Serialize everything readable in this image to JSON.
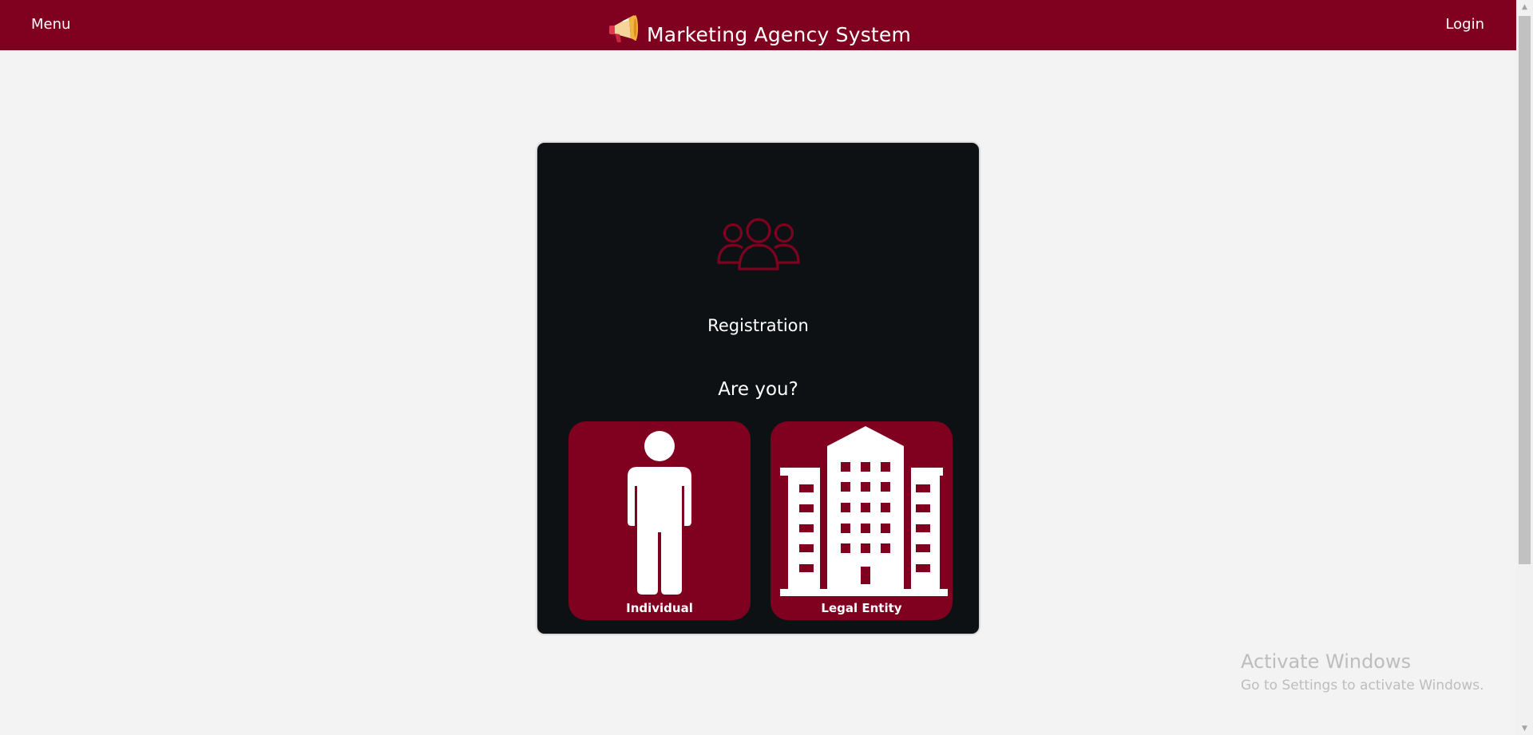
{
  "header": {
    "menu_label": "Menu",
    "title": "Marketing Agency System",
    "logo_icon": "megaphone-icon",
    "login_label": "Login"
  },
  "card": {
    "icon": "users-group-icon",
    "title": "Registration",
    "question": "Are you?",
    "options": [
      {
        "label": "Individual",
        "icon": "person-icon"
      },
      {
        "label": "Legal Entity",
        "icon": "building-icon"
      }
    ]
  },
  "watermark": {
    "title": "Activate Windows",
    "subtitle": "Go to Settings to activate Windows."
  },
  "colors": {
    "brand": "#800020",
    "background": "#f3f3f3",
    "card": "#0e1113",
    "text_light": "#ffffff"
  }
}
